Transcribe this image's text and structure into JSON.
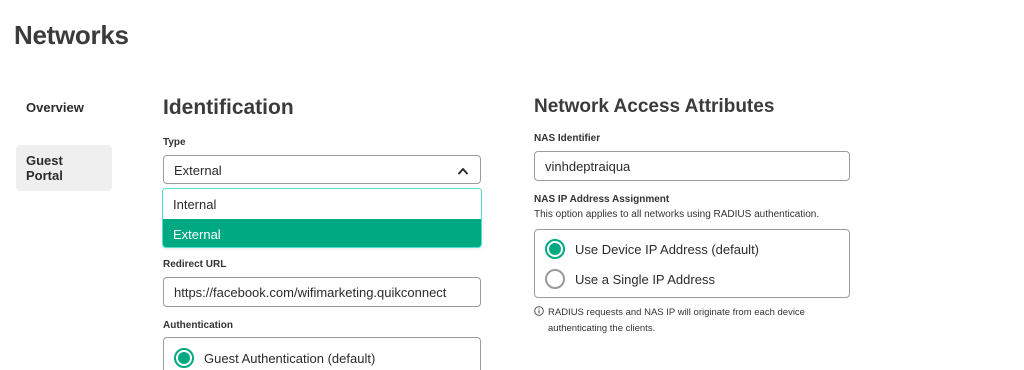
{
  "page": {
    "title": "Networks"
  },
  "sidebar": {
    "items": [
      {
        "label": "Overview"
      },
      {
        "label": "Guest Portal"
      }
    ]
  },
  "identification": {
    "title": "Identification",
    "type_label": "Type",
    "type_value": "External",
    "type_options": [
      "Internal",
      "External"
    ],
    "redirect_label": "Redirect URL",
    "redirect_value": "https://facebook.com/wifimarketing.quikconnect",
    "auth_label": "Authentication",
    "auth_options": [
      "Guest Authentication (default)"
    ]
  },
  "network_access": {
    "title": "Network Access Attributes",
    "nas_id_label": "NAS Identifier",
    "nas_id_value": "vinhdeptraiqua",
    "nas_ip_label": "NAS IP Address Assignment",
    "nas_ip_help": "This option applies to all networks using RADIUS authentication.",
    "nas_ip_options": [
      "Use Device IP Address (default)",
      "Use a Single IP Address"
    ],
    "nas_ip_selected": "Use Device IP Address (default)",
    "info_text": "RADIUS requests and NAS IP will originate from each device authenticating the clients."
  },
  "colors": {
    "accent": "#01a982",
    "focus_border": "#52e0d0",
    "border": "#9b9b9b",
    "nav_selected_bg": "#efefef"
  },
  "icons": {
    "select_toggle": "chevron-up-icon",
    "info": "info-icon"
  }
}
